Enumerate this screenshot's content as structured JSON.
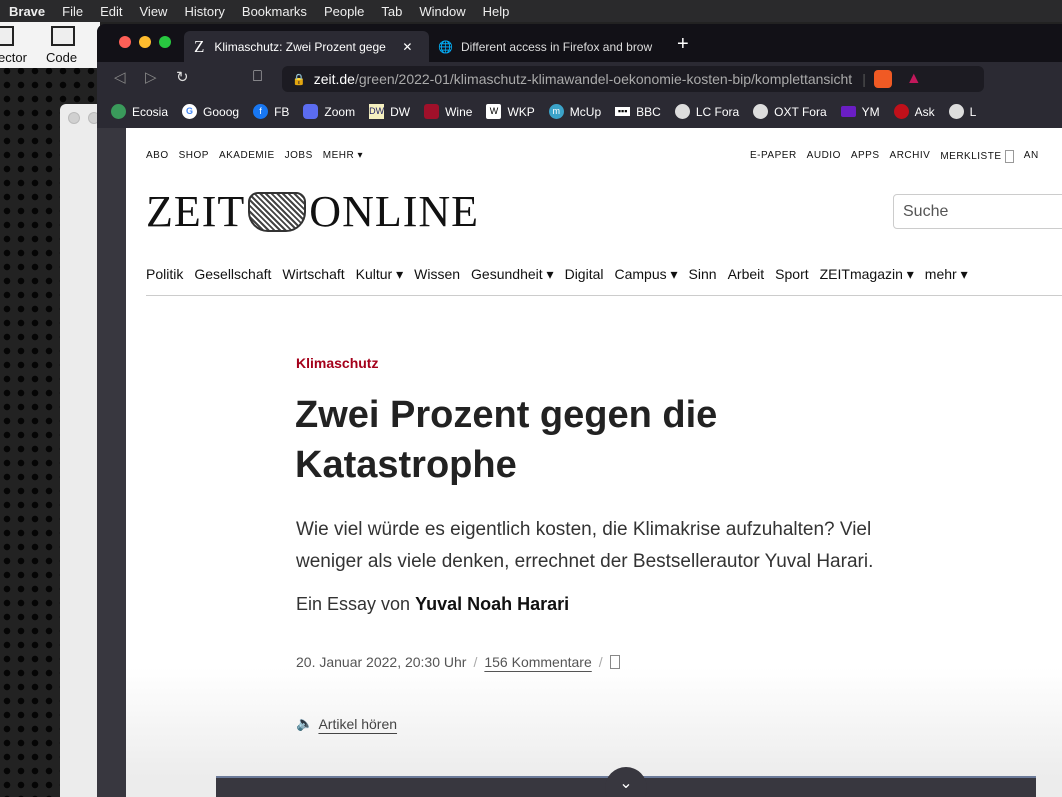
{
  "menubar": {
    "items": [
      "Brave",
      "File",
      "Edit",
      "View",
      "History",
      "Bookmarks",
      "People",
      "Tab",
      "Window",
      "Help"
    ]
  },
  "background_app": {
    "tools": [
      "ector",
      "Code"
    ]
  },
  "tabs": [
    {
      "label": "Klimaschutz: Zwei Prozent gege",
      "favicon": "Z",
      "active": true
    },
    {
      "label": "Different access in Firefox and brow",
      "active": false
    }
  ],
  "url": {
    "host": "zeit.de",
    "path": "/green/2022-01/klimaschutz-klimawandel-oekonomie-kosten-bip/komplettansicht"
  },
  "bookmarks": [
    {
      "label": "Ecosia",
      "color": "#3a9a5b"
    },
    {
      "label": "Gooog",
      "color": "#4285f4"
    },
    {
      "label": "FB",
      "color": "#1877f2"
    },
    {
      "label": "Zoom",
      "color": "#5b6cf0"
    },
    {
      "label": "DW",
      "color": "#f5f0c0"
    },
    {
      "label": "Wine",
      "color": "#a0102a"
    },
    {
      "label": "WKP",
      "color": "#ffffff"
    },
    {
      "label": "McUp",
      "color": "#3ba3c9"
    },
    {
      "label": "BBC",
      "color": "#ffffff"
    },
    {
      "label": "LC Fora",
      "color": "#dddddd"
    },
    {
      "label": "OXT Fora",
      "color": "#dddddd"
    },
    {
      "label": "YM",
      "color": "#6a1ec4"
    },
    {
      "label": "Ask",
      "color": "#c0101a"
    },
    {
      "label": "L",
      "color": "#dddddd"
    }
  ],
  "site": {
    "topnav_left": [
      "ABO",
      "SHOP",
      "AKADEMIE",
      "JOBS",
      "MEHR ▾"
    ],
    "topnav_right": [
      "E-PAPER",
      "AUDIO",
      "APPS",
      "ARCHIV",
      "MERKLISTE",
      "AN"
    ],
    "logo_left": "ZEIT",
    "logo_right": "ONLINE",
    "search_placeholder": "Suche",
    "mainnav": [
      "Politik",
      "Gesellschaft",
      "Wirtschaft",
      "Kultur ▾",
      "Wissen",
      "Gesundheit ▾",
      "Digital",
      "Campus ▾",
      "Sinn",
      "Arbeit",
      "Sport",
      "ZEITmagazin ▾",
      "mehr ▾"
    ]
  },
  "article": {
    "kicker": "Klimaschutz",
    "title": "Zwei Prozent gegen die Katastrophe",
    "lead": "Wie viel würde es eigentlich kosten, die Klimakrise aufzuhalten? Viel weniger als viele denken, errechnet der Bestsellerautor Yuval Harari.",
    "byline_prefix": "Ein Essay von",
    "author": "Yuval Noah Harari",
    "date": "20. Januar 2022, 20:30 Uhr",
    "comments": "156 Kommentare",
    "listen": "Artikel hören"
  },
  "accent": "#a4001a"
}
